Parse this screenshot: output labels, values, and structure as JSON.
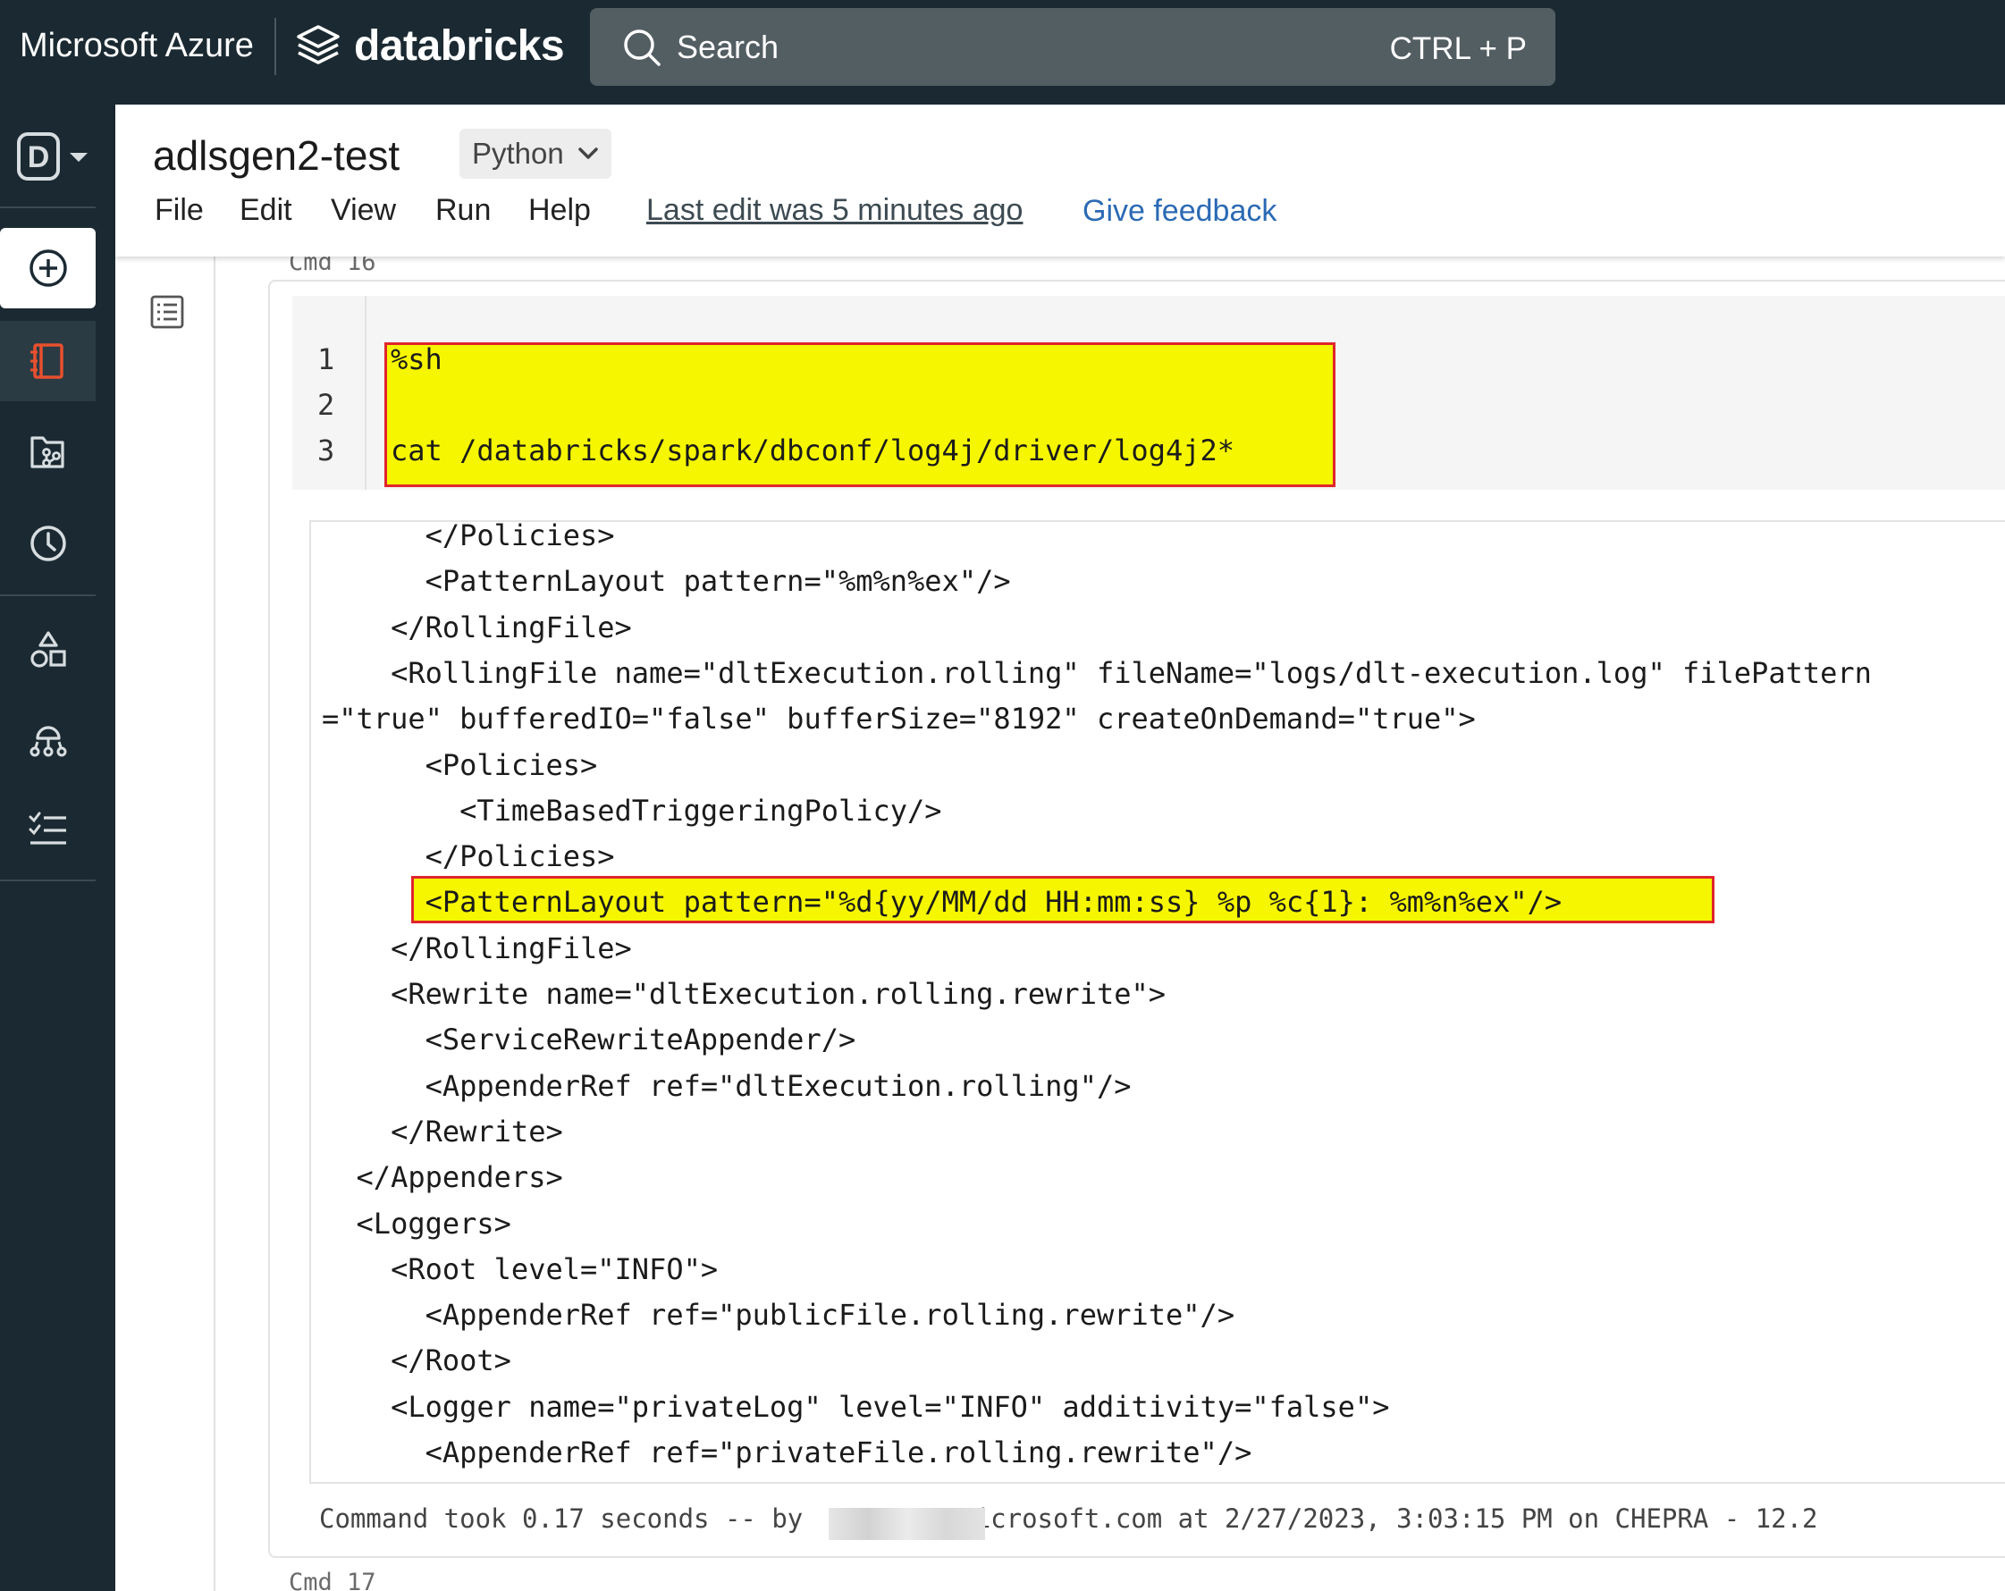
{
  "topbar": {
    "azure_label": "Microsoft Azure",
    "brand_label": "databricks",
    "search_label": "Search",
    "search_shortcut": "CTRL + P"
  },
  "sidebar": {
    "workspace_letter": "D",
    "items": [
      {
        "icon": "plus-circle-icon",
        "label": "New"
      },
      {
        "icon": "notebook-icon",
        "label": "Workspace"
      },
      {
        "icon": "repos-icon",
        "label": "Repos"
      },
      {
        "icon": "clock-icon",
        "label": "Recents"
      },
      {
        "icon": "shapes-icon",
        "label": "Data"
      },
      {
        "icon": "cluster-icon",
        "label": "Compute"
      },
      {
        "icon": "workflows-icon",
        "label": "Workflows"
      }
    ]
  },
  "notebook": {
    "title": "adlsgen2-test",
    "language": "Python",
    "menu": [
      "File",
      "Edit",
      "View",
      "Run",
      "Help"
    ],
    "last_edit": "Last edit was 5 minutes ago",
    "feedback": "Give feedback"
  },
  "cell": {
    "cmd_label": "Cmd 16",
    "next_cmd_label": "Cmd 17",
    "line_numbers": [
      "1",
      "2",
      "3"
    ],
    "source": [
      "%sh",
      "",
      "cat /databricks/spark/dbconf/log4j/driver/log4j2*"
    ],
    "output_lines": [
      "      </Policies>",
      "      <PatternLayout pattern=\"%m%n%ex\"/>",
      "    </RollingFile>",
      "    <RollingFile name=\"dltExecution.rolling\" fileName=\"logs/dlt-execution.log\" filePattern",
      "=\"true\" bufferedIO=\"false\" bufferSize=\"8192\" createOnDemand=\"true\">",
      "      <Policies>",
      "        <TimeBasedTriggeringPolicy/>",
      "      </Policies>",
      "      <PatternLayout pattern=\"%d{yy/MM/dd HH:mm:ss} %p %c{1}: %m%n%ex\"/>",
      "    </RollingFile>",
      "    <Rewrite name=\"dltExecution.rolling.rewrite\">",
      "      <ServiceRewriteAppender/>",
      "      <AppenderRef ref=\"dltExecution.rolling\"/>",
      "    </Rewrite>",
      "  </Appenders>",
      "  <Loggers>",
      "    <Root level=\"INFO\">",
      "      <AppenderRef ref=\"publicFile.rolling.rewrite\"/>",
      "    </Root>",
      "    <Logger name=\"privateLog\" level=\"INFO\" additivity=\"false\">",
      "      <AppenderRef ref=\"privateFile.rolling.rewrite\"/>"
    ],
    "footer_prefix": "Command took 0.17 seconds -- by ",
    "footer_suffix": "icrosoft.com at 2/27/2023, 3:03:15 PM on CHEPRA - 12.2"
  },
  "colors": {
    "topbar_bg": "#1b2a32",
    "search_bg": "#535e63",
    "highlight_fill": "#f6f600",
    "highlight_border": "#e0252c",
    "link": "#2b6ab4",
    "workspace_active": "#e8502e"
  }
}
